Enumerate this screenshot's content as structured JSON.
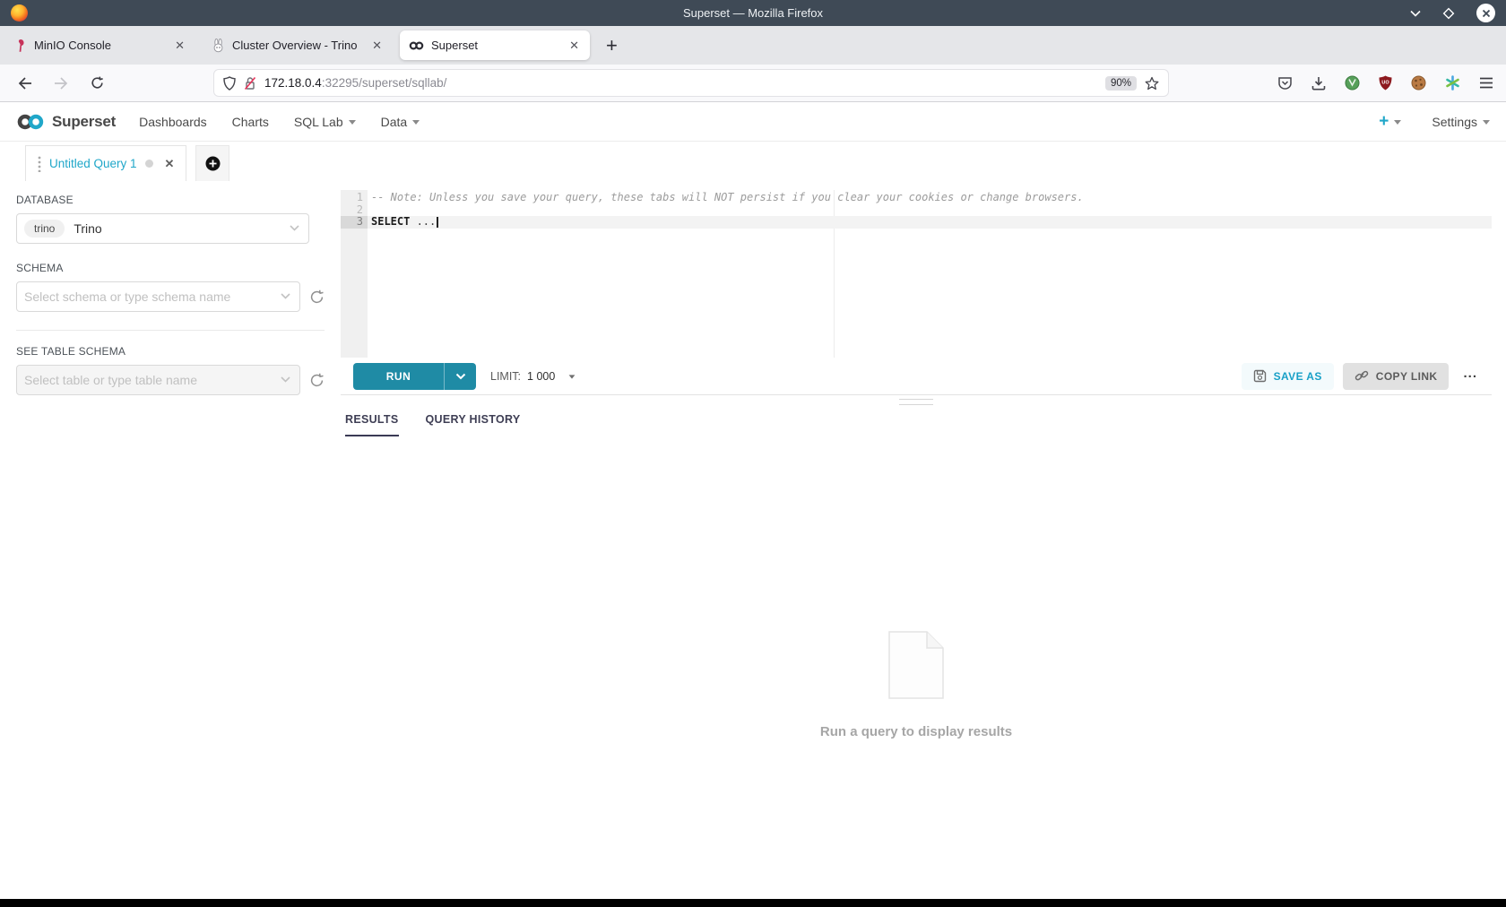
{
  "colors": {
    "accent": "#20a7c9",
    "run_button": "#1f8ba5",
    "titlebar": "#3f4a56",
    "results_ink": "#3a3a55"
  },
  "window": {
    "title": "Superset — Mozilla Firefox",
    "tabs": [
      {
        "title": "MinIO Console",
        "icon": "minio-icon"
      },
      {
        "title": "Cluster Overview - Trino",
        "icon": "trino-icon"
      },
      {
        "title": "Superset",
        "icon": "superset-icon"
      }
    ],
    "new_tab_label": "+",
    "urlbar": {
      "host": "172.18.0.4",
      "path": ":32295/superset/sqllab/",
      "zoom_badge": "90%"
    },
    "toolbar_icons": [
      "pocket-icon",
      "download-icon",
      "extension-green-icon",
      "ublock-shield-icon",
      "cookie-icon",
      "container-asterisk-icon",
      "menu-icon"
    ]
  },
  "navbar": {
    "brand": "Superset",
    "items": {
      "dashboards": "Dashboards",
      "charts": "Charts",
      "sql_lab": "SQL Lab",
      "data": "Data"
    },
    "new_label": "+",
    "settings_label": "Settings"
  },
  "query_tabs": {
    "active_label": "Untitled Query 1"
  },
  "sidebar": {
    "database": {
      "label": "DATABASE",
      "tag": "trino",
      "value": "Trino"
    },
    "schema": {
      "label": "SCHEMA",
      "placeholder": "Select schema or type schema name"
    },
    "table": {
      "label": "SEE TABLE SCHEMA",
      "placeholder": "Select table or type table name"
    }
  },
  "editor": {
    "line_numbers": [
      "1",
      "2",
      "3"
    ],
    "comment_line": "-- Note: Unless you save your query, these tabs will NOT persist if you clear your cookies or change browsers.",
    "keyword": "SELECT",
    "code_rest": " ..."
  },
  "toolbar": {
    "run_label": "RUN",
    "limit_label": "LIMIT:",
    "limit_value": "1 000",
    "save_as_label": "SAVE AS",
    "copy_link_label": "COPY LINK",
    "more_label": "..."
  },
  "results": {
    "tabs": [
      {
        "label": "RESULTS"
      },
      {
        "label": "QUERY HISTORY"
      }
    ],
    "empty_message": "Run a query to display results"
  }
}
